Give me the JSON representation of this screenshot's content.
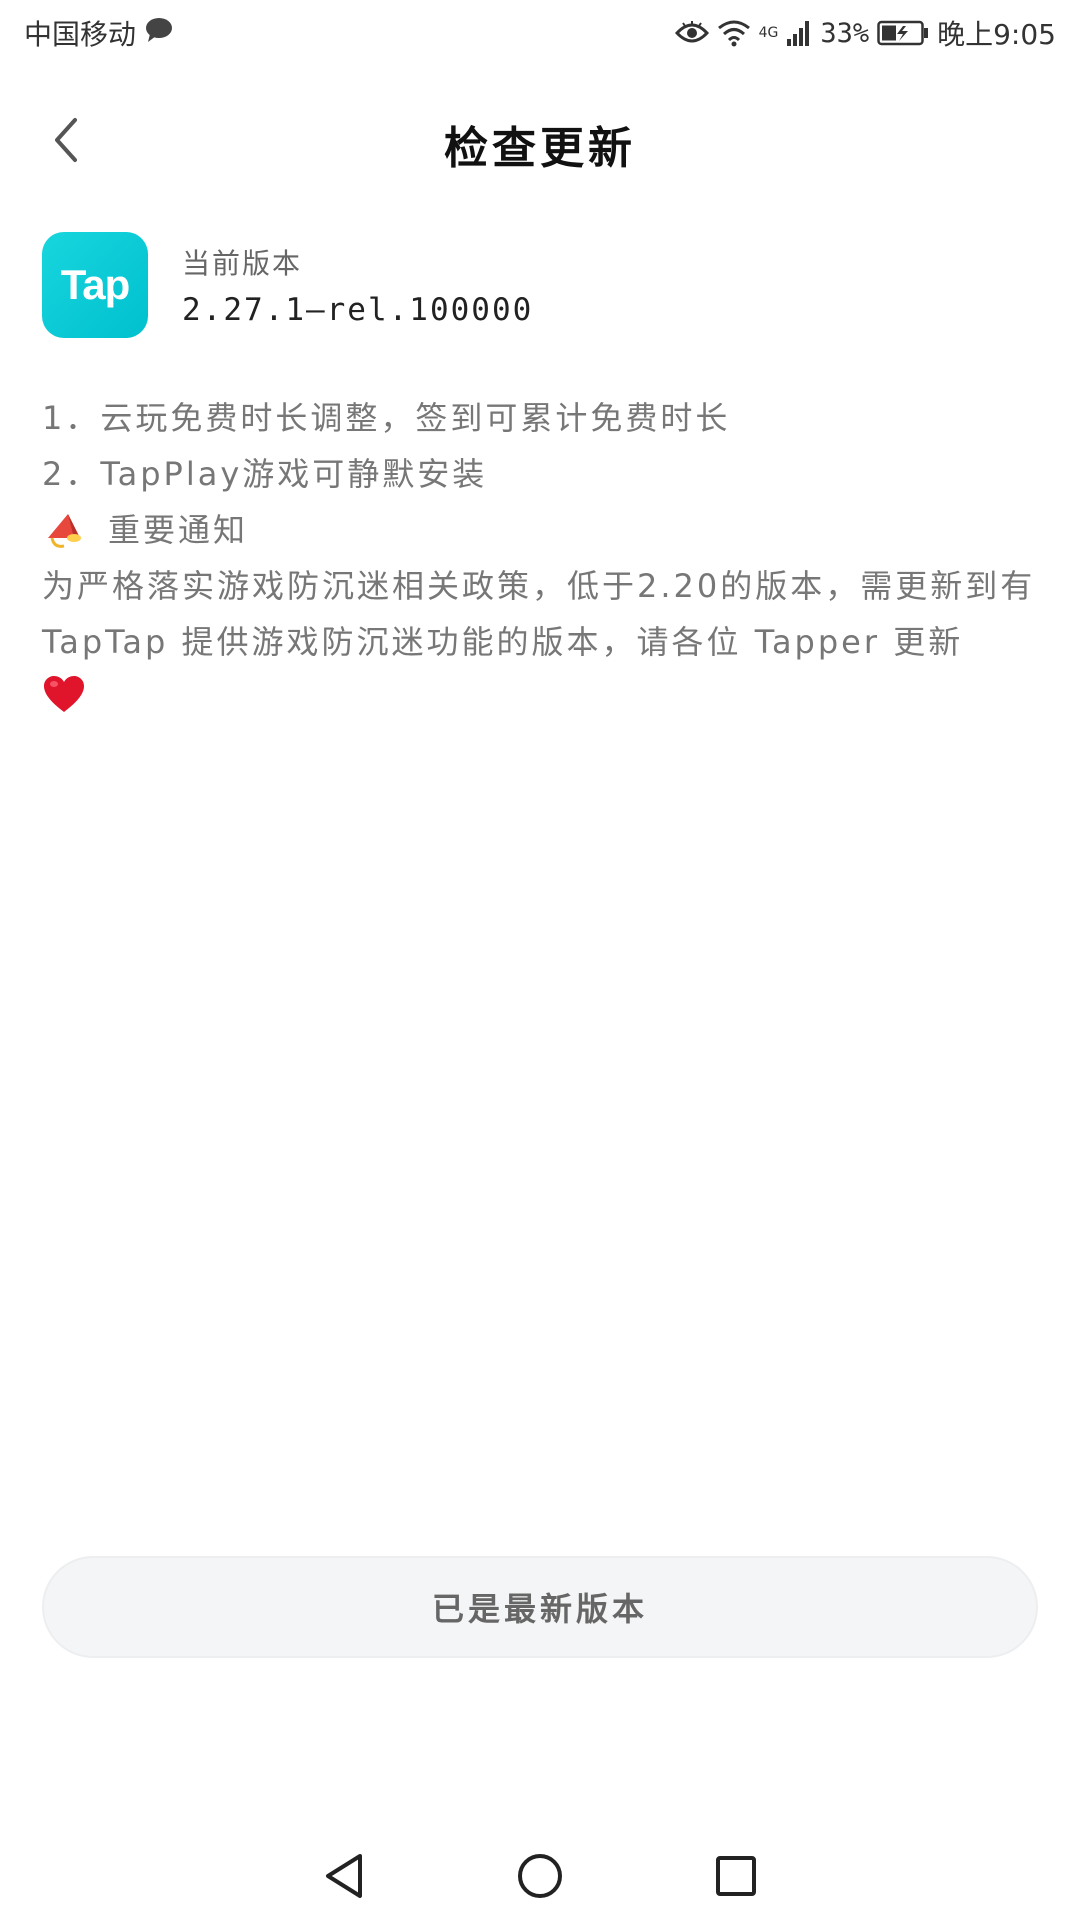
{
  "status_bar": {
    "carrier": "中国移动",
    "network": "4G",
    "battery": "33%",
    "time": "晚上9:05"
  },
  "header": {
    "title": "检查更新"
  },
  "app": {
    "icon_text": "Tap",
    "version_label": "当前版本",
    "version_value": "2.27.1—rel.100000"
  },
  "notes": {
    "line1": "1．云玩免费时长调整，签到可累计免费时长",
    "line2": "2．TapPlay游戏可静默安装",
    "notice_title": "重要通知",
    "paragraph": "为严格落实游戏防沉迷相关政策，低于2.20的版本，需更新到有 TapTap 提供游戏防沉迷功能的版本，请各位 Tapper 更新"
  },
  "button": {
    "label": "已是最新版本"
  },
  "colors": {
    "accent": "#18d6dd",
    "button_bg": "#f4f5f6",
    "heart": "#e0142b",
    "megaphone": "#e8483c"
  }
}
